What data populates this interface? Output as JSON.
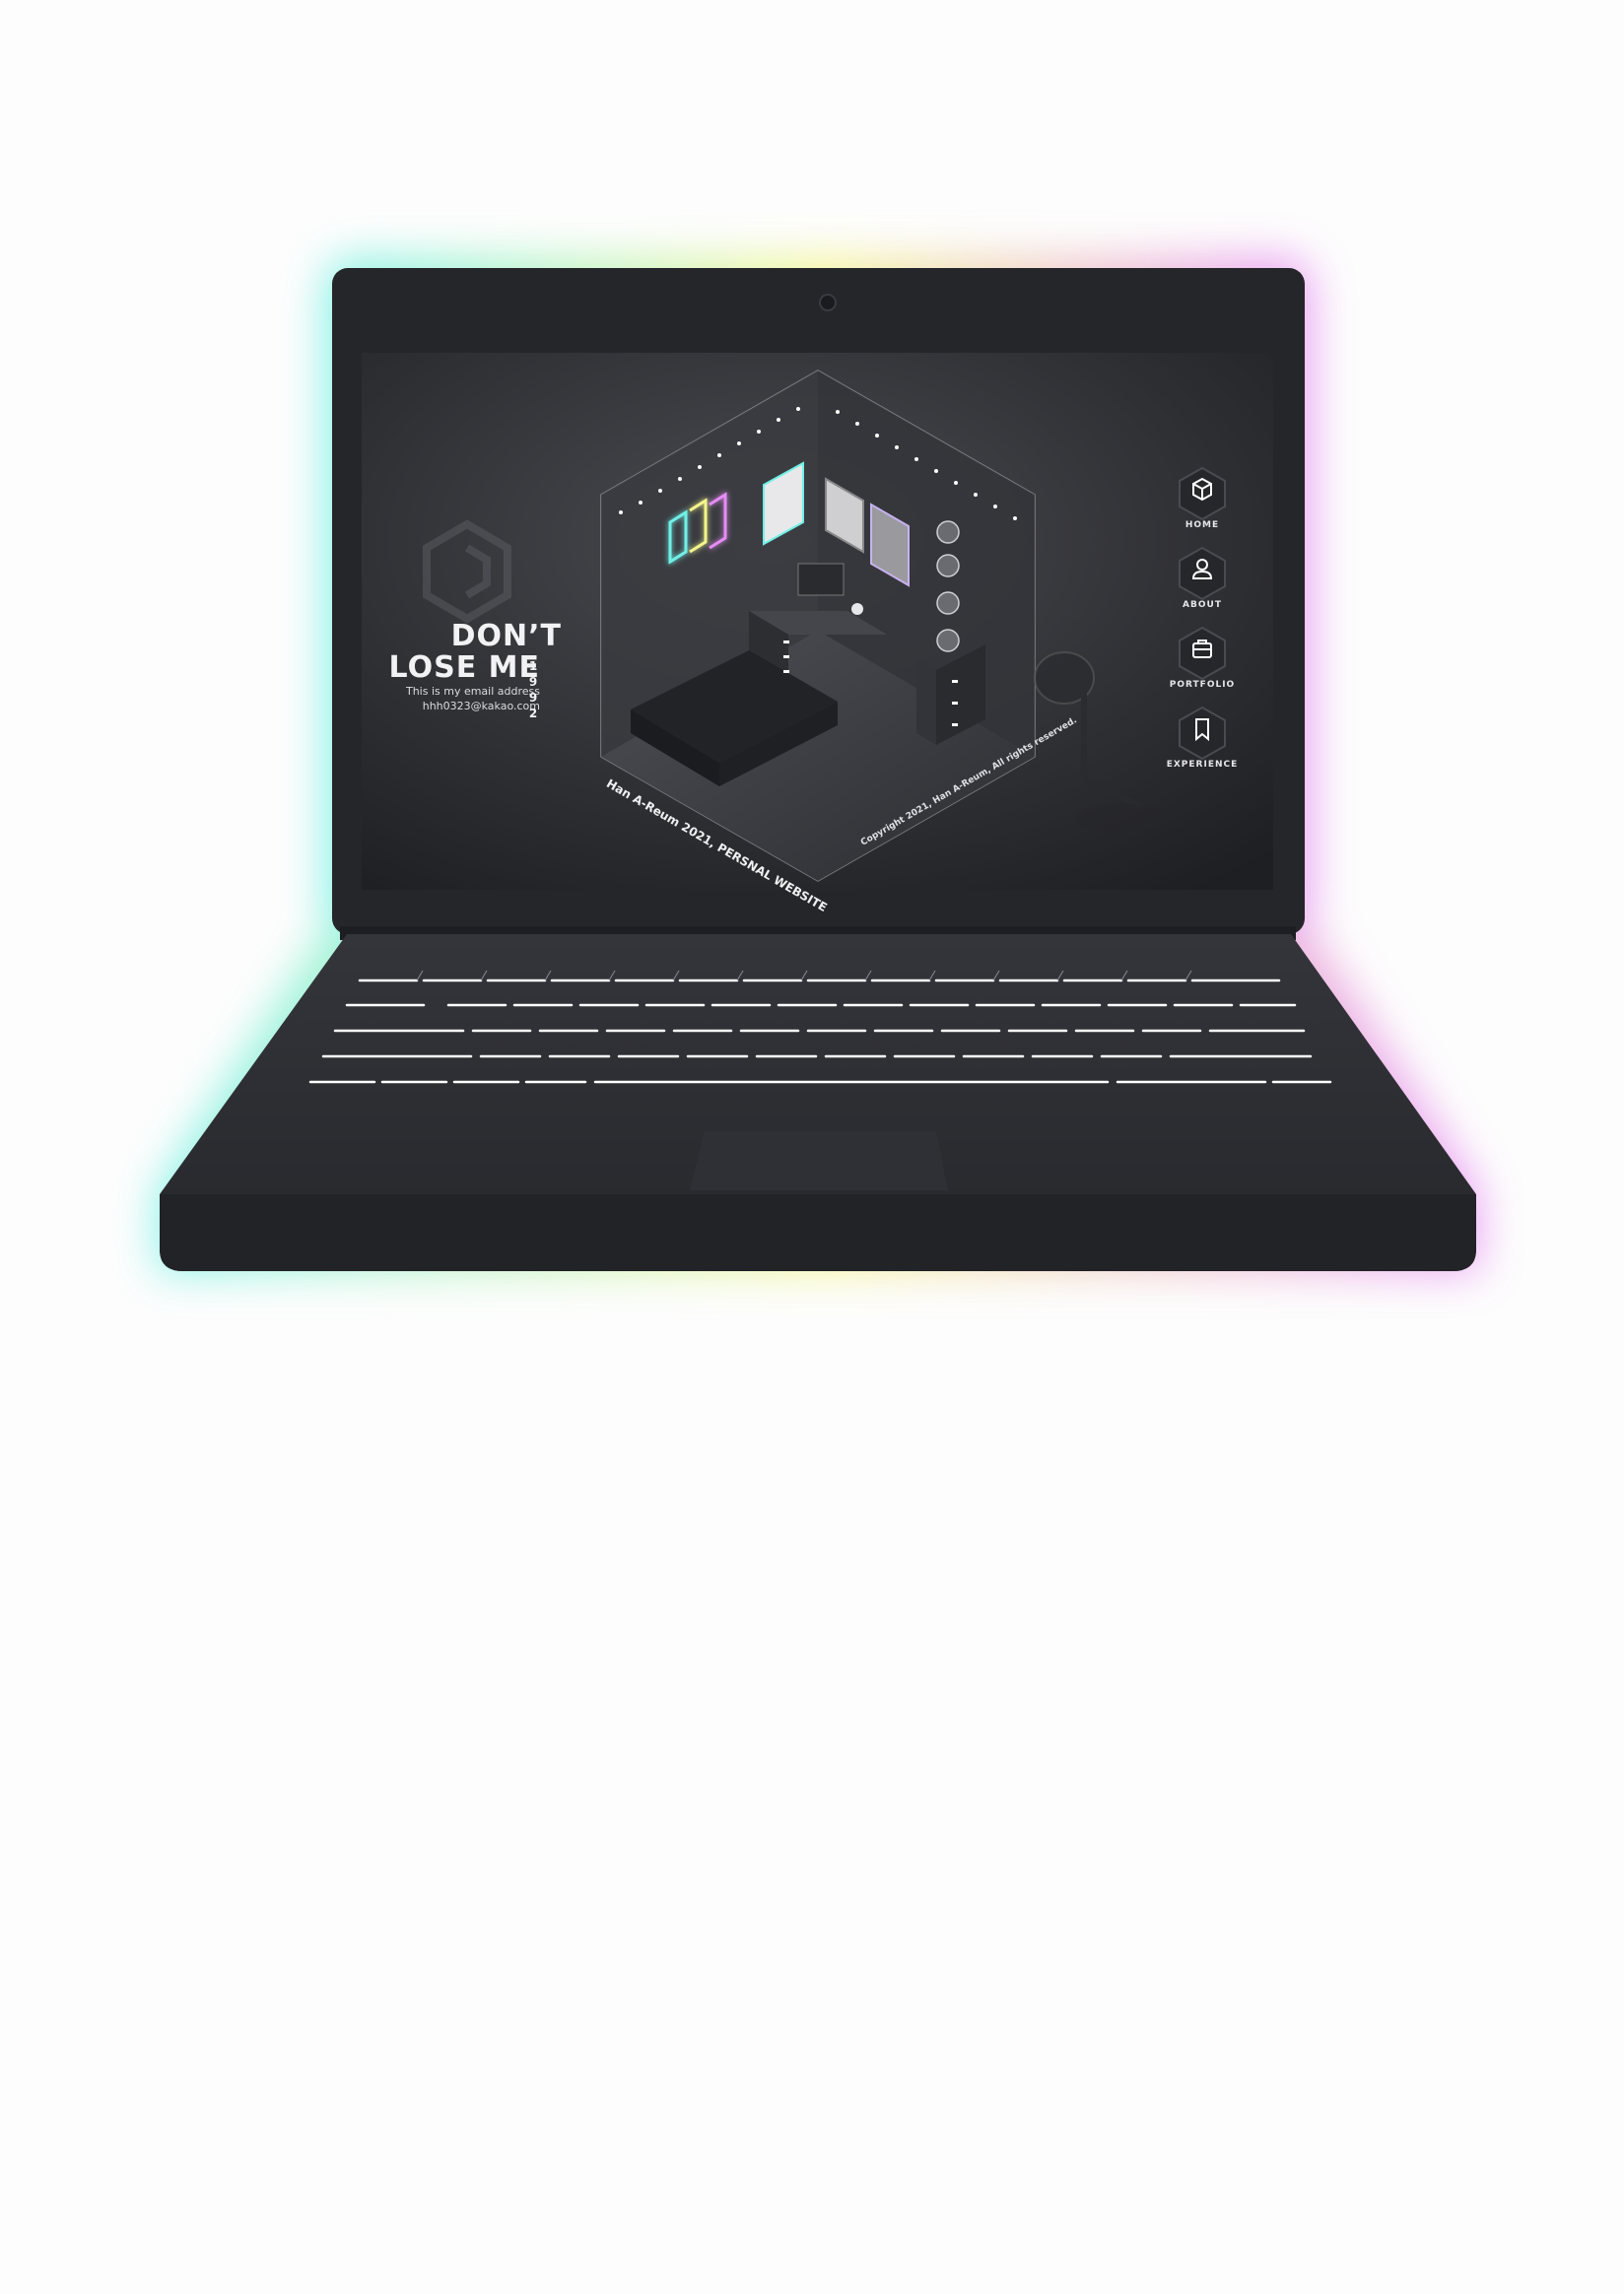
{
  "website": {
    "brand": {
      "title_line1": "DON’T",
      "title_line2": "LOSE ME",
      "year_digits": [
        "1",
        "9",
        "9",
        "2"
      ],
      "email_note": "This is my email address",
      "email": "hhh0323@kakao.com",
      "logo_icon": "hexagon-logo-icon"
    },
    "room": {
      "title": "Han A-Reum 2021, PERSNAL WEBSITE",
      "copyright": "Copyright 2021, Han A-Reum, All rights reserved."
    },
    "nav": [
      {
        "label": "HOME",
        "icon": "cube-icon"
      },
      {
        "label": "ABOUT",
        "icon": "user-icon"
      },
      {
        "label": "PORTFOLIO",
        "icon": "briefcase-icon"
      },
      {
        "label": "EXPERIENCE",
        "icon": "bookmark-icon"
      }
    ]
  },
  "colors": {
    "laptop_body": "#26272b",
    "screen_bg": "#2e2f33",
    "accent_teal": "#6ff0e6",
    "accent_yellow": "#f3f58a",
    "accent_pink": "#e58cf5"
  }
}
